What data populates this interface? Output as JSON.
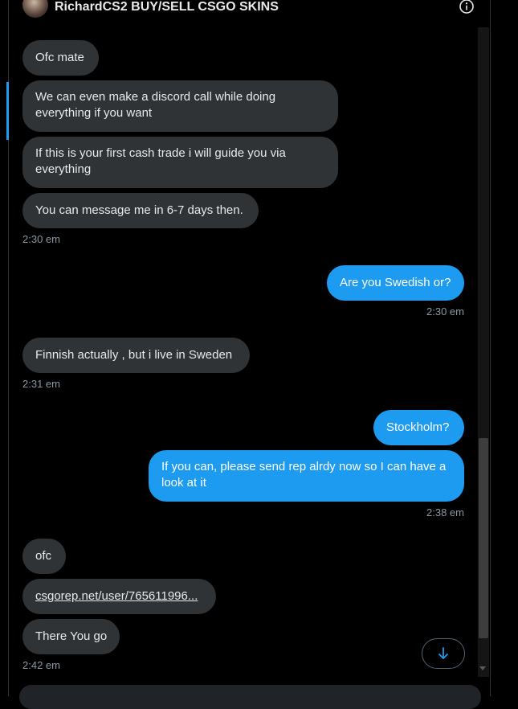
{
  "header": {
    "title": "RichardCS2 BUY/SELL CSGO SKINS",
    "info_icon": "info-circle-icon"
  },
  "messages": [
    {
      "text": "Ofc mate",
      "direction": "incoming"
    },
    {
      "text": "We can even make a discord call while doing everything if you want",
      "direction": "incoming"
    },
    {
      "text": "If this is your first cash trade i will guide you via everything",
      "direction": "incoming"
    },
    {
      "text": "You can message me in 6-7 days then.",
      "direction": "incoming",
      "time": "2:30 em"
    },
    {
      "text": "Are you Swedish or?",
      "direction": "outgoing",
      "time": "2:30 em"
    },
    {
      "text": "Finnish actually , but i live in Sweden",
      "direction": "incoming",
      "time": "2:31 em"
    },
    {
      "text": "Stockholm?",
      "direction": "outgoing"
    },
    {
      "text": "If you can, please send rep alrdy now so I can have a look at it",
      "direction": "outgoing",
      "time": "2:38 em"
    },
    {
      "text": "ofc",
      "direction": "incoming"
    },
    {
      "text": "csgorep.net/user/765611996...",
      "direction": "incoming",
      "is_link": true
    },
    {
      "text": "There You go",
      "direction": "incoming",
      "time": "2:42 em"
    }
  ],
  "scroll_down_button": {
    "icon": "arrow-down-icon"
  },
  "colors": {
    "incoming_bubble": "#2f3336",
    "outgoing_bubble": "#1d9bf0",
    "background": "#000000",
    "timestamp": "#8b98a5"
  }
}
